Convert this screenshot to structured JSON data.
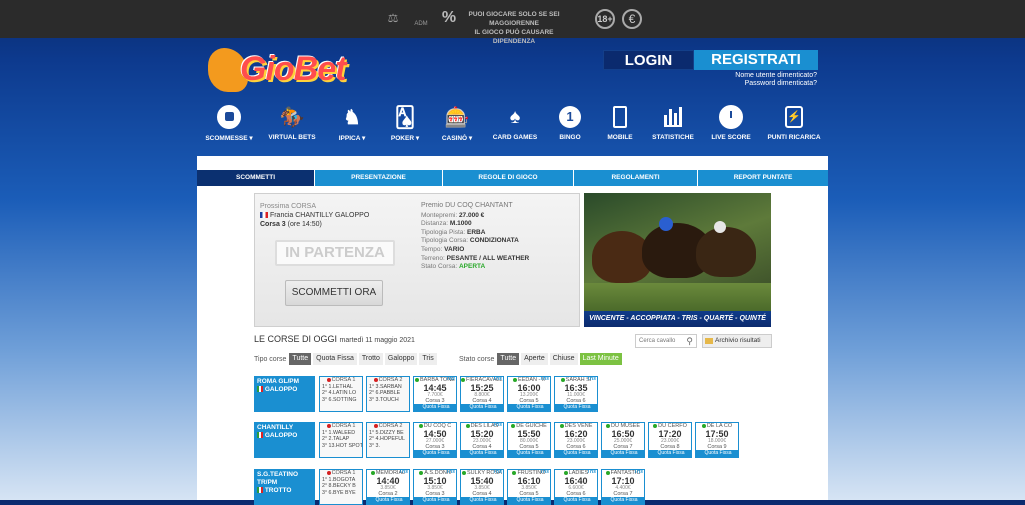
{
  "topbar": {
    "adm_label": "ADM",
    "age_warning_line1": "PUOI GIOCARE SOLO SE SEI MAGGIORENNE",
    "age_warning_line2": "IL GIOCO PUÒ CAUSARE DIPENDENZA",
    "age_badge": "18+",
    "percent_icon": "%",
    "euro_icon": "€"
  },
  "header": {
    "logo_text": "GioBet",
    "login_label": "LOGIN",
    "register_label": "REGISTRATI",
    "forgot_user": "Nome utente dimenticato?",
    "forgot_password": "Password dimenticata?"
  },
  "nav": [
    {
      "label": "SCOMMESSE ▾"
    },
    {
      "label": "VIRTUAL BETS"
    },
    {
      "label": "IPPICA ▾"
    },
    {
      "label": "POKER ▾"
    },
    {
      "label": "CASINÒ ▾"
    },
    {
      "label": "CARD GAMES"
    },
    {
      "label": "BINGO"
    },
    {
      "label": "MOBILE"
    },
    {
      "label": "STATISTICHE"
    },
    {
      "label": "LIVE SCORE"
    },
    {
      "label": "PUNTI RICARICA"
    }
  ],
  "tabs": [
    {
      "label": "SCOMMETTI",
      "active": true
    },
    {
      "label": "PRESENTAZIONE"
    },
    {
      "label": "REGOLE DI GIOCO"
    },
    {
      "label": "REGOLAMENTI"
    },
    {
      "label": "REPORT PUNTATE"
    }
  ],
  "next_race": {
    "heading": "Prossima CORSA",
    "venue": "Francia CHANTILLY GALOPPO",
    "race": "Corsa 3",
    "time": "(ore 14:50)",
    "status_button": "IN PARTENZA",
    "bet_button": "SCOMMETTI ORA",
    "prize_title": "Premio DU COQ CHANTANT",
    "details": [
      {
        "k": "Montepremi:",
        "v": "27.000 €"
      },
      {
        "k": "Distanza:",
        "v": "M.1000"
      },
      {
        "k": "Tipologia Pista:",
        "v": "ERBA"
      },
      {
        "k": "Tipologia Corsa:",
        "v": "CONDIZIONATA"
      },
      {
        "k": "Tempo:",
        "v": "VARIO"
      },
      {
        "k": "Terreno:",
        "v": "PESANTE / ALL WEATHER"
      },
      {
        "k": "Stato Corsa:",
        "v": "APERTA"
      }
    ],
    "banner_caption": "VINCENTE - ACCOPPIATA - TRIS - QUARTÉ - QUINTÉ"
  },
  "races_today": {
    "title": "LE CORSE DI OGGI",
    "date": "martedì 11 maggio 2021",
    "search_placeholder": "Cerca cavallo",
    "archive_label": "Archivio risultati",
    "tipo_label": "Tipo corse",
    "tipo_options": [
      "Tutte",
      "Quota Fissa",
      "Trotto",
      "Galoppo",
      "Tris"
    ],
    "stato_label": "Stato corse",
    "stato_options": [
      "Tutte",
      "Aperte",
      "Chiuse",
      "Last Minute"
    ]
  },
  "meetings": [
    {
      "venue": "ROMA GL/PM",
      "type": "GALOPPO",
      "results": [
        {
          "title": "CORSA 1",
          "lines": [
            "1° 1.LETHAL",
            "2° 4.LATIN LO",
            "3° 6.SOTTING"
          ]
        },
        {
          "title": "CORSA 2",
          "lines": [
            "1° 3.SARBAN",
            "2° 6.PABBLE",
            "3° 3.TOUCH"
          ]
        }
      ],
      "races": [
        {
          "title": "BARBA TONE",
          "time": "14:45",
          "amount": "7.700€",
          "corsa": "Corsa 3",
          "foot": "Quota Fissa",
          "tris": true
        },
        {
          "title": "FIERACAVALLI",
          "time": "15:25",
          "amount": "8.800€",
          "corsa": "Corsa 4",
          "foot": "Quota Fissa",
          "tris": true
        },
        {
          "title": "EEDAN - II",
          "time": "16:00",
          "amount": "13.200€",
          "corsa": "Corsa 5",
          "foot": "Quota Fissa",
          "tris": true
        },
        {
          "title": "SARAH SI",
          "time": "16:35",
          "amount": "11.000€",
          "corsa": "Corsa 6",
          "foot": "Quota Fissa",
          "tris": true
        }
      ]
    },
    {
      "venue": "CHANTILLY",
      "type": "GALOPPO",
      "results": [
        {
          "title": "CORSA 1",
          "lines": [
            "1° 1.WALEED",
            "2° 2.TALAP",
            "3° 13.HOT SPOT"
          ]
        },
        {
          "title": "CORSA 2",
          "lines": [
            "1° 5.DIZZY BE",
            "2° 4.HOPEFUL",
            "3° 3."
          ]
        }
      ],
      "races": [
        {
          "title": "DU COQ C",
          "time": "14:50",
          "amount": "27.000€",
          "corsa": "Corsa 3",
          "foot": "Quota Fissa",
          "tris": false
        },
        {
          "title": "DES LILAS",
          "time": "15:20",
          "amount": "23.000€",
          "corsa": "Corsa 4",
          "foot": "Quota Fissa",
          "tris": true
        },
        {
          "title": "DE GUICHE",
          "time": "15:50",
          "amount": "80.000€",
          "corsa": "Corsa 5",
          "foot": "Quota Fissa",
          "tris": false
        },
        {
          "title": "DES VENE",
          "time": "16:20",
          "amount": "23.000€",
          "corsa": "Corsa 6",
          "foot": "Quota Fissa",
          "tris": false
        },
        {
          "title": "DU MUSEE",
          "time": "16:50",
          "amount": "25.000€",
          "corsa": "Corsa 7",
          "foot": "Quota Fissa",
          "tris": false
        },
        {
          "title": "DU CERFO",
          "time": "17:20",
          "amount": "23.000€",
          "corsa": "Corsa 8",
          "foot": "Quota Fissa",
          "tris": false
        },
        {
          "title": "DE LA CO",
          "time": "17:50",
          "amount": "18.000€",
          "corsa": "Corsa 9",
          "foot": "Quota Fissa",
          "tris": false
        }
      ]
    },
    {
      "venue": "S.G.TEATINO TR/PM",
      "type": "TROTTO",
      "results": [
        {
          "title": "CORSA 1",
          "lines": [
            "1° 1.BOGOTA",
            "2° 8.BECKY B",
            "3° 6.BYE BYE"
          ]
        }
      ],
      "races": [
        {
          "title": "MEMORIAL",
          "time": "14:40",
          "amount": "3.850€",
          "corsa": "Corsa 2",
          "foot": "Quota Fissa",
          "tris": true
        },
        {
          "title": "A.S.DONN",
          "time": "15:10",
          "amount": "3.850€",
          "corsa": "Corsa 3",
          "foot": "Quota Fissa",
          "tris": true
        },
        {
          "title": "SULKY ROSA",
          "time": "15:40",
          "amount": "3.850€",
          "corsa": "Corsa 4",
          "foot": "Quota Fissa",
          "tris": true
        },
        {
          "title": "FRUSTINO",
          "time": "16:10",
          "amount": "3.850€",
          "corsa": "Corsa 5",
          "foot": "Quota Fissa",
          "tris": true
        },
        {
          "title": "LADIES",
          "time": "16:40",
          "amount": "6.600€",
          "corsa": "Corsa 6",
          "foot": "Quota Fissa",
          "tris": true
        },
        {
          "title": "FANTASTIC",
          "time": "17:10",
          "amount": "4.400€",
          "corsa": "Corsa 7",
          "foot": "Quota Fissa",
          "tris": true
        }
      ]
    }
  ],
  "colors": {
    "accent": "#1a8fd1",
    "dark_blue": "#0b2a6e",
    "open_green": "#28a828",
    "closed_red": "#d62020"
  }
}
